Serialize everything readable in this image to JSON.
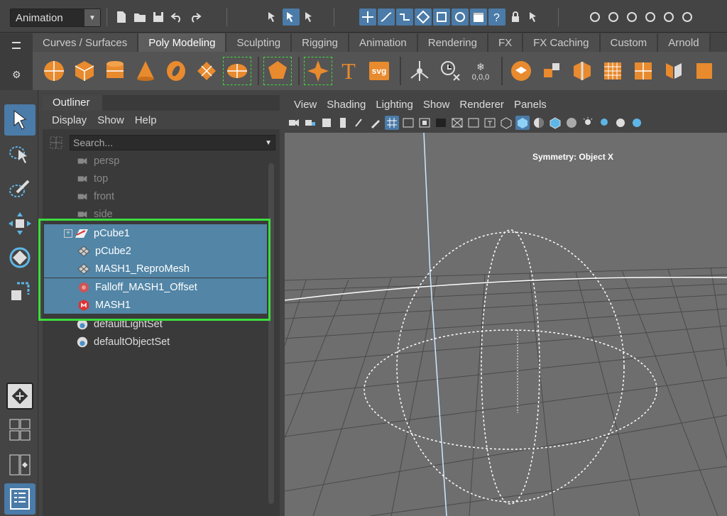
{
  "statusbar": {
    "menu_set": "Animation"
  },
  "shelf": {
    "tabs": [
      "Curves / Surfaces",
      "Poly Modeling",
      "Sculpting",
      "Rigging",
      "Animation",
      "Rendering",
      "FX",
      "FX Caching",
      "Custom",
      "Arnold"
    ],
    "active_tab": "Poly Modeling",
    "svg_label": "svg",
    "text_tool_label": "T",
    "snow_label": "0,0,0"
  },
  "outliner": {
    "tab": "Outliner",
    "menu": [
      "Display",
      "Show",
      "Help"
    ],
    "search_placeholder": "Search...",
    "items": [
      {
        "label": "persp",
        "icon": "camera-icon",
        "state": "dim"
      },
      {
        "label": "top",
        "icon": "camera-icon",
        "state": "dim"
      },
      {
        "label": "front",
        "icon": "camera-icon",
        "state": "dim"
      },
      {
        "label": "side",
        "icon": "camera-icon",
        "state": "dim"
      },
      {
        "label": "pCube1",
        "icon": "transform-icon",
        "state": "selected"
      },
      {
        "label": "pCube2",
        "icon": "mesh-icon",
        "state": "selected"
      },
      {
        "label": "MASH1_ReproMesh",
        "icon": "mesh-icon",
        "state": "selected"
      },
      {
        "label": "Falloff_MASH1_Offset",
        "icon": "falloff-icon",
        "state": "selected"
      },
      {
        "label": "MASH1",
        "icon": "mash-icon",
        "state": "selected"
      },
      {
        "label": "defaultLightSet",
        "icon": "set-icon",
        "state": "normal"
      },
      {
        "label": "defaultObjectSet",
        "icon": "set-icon",
        "state": "normal"
      }
    ]
  },
  "viewport": {
    "menu": [
      "View",
      "Shading",
      "Lighting",
      "Show",
      "Renderer",
      "Panels"
    ],
    "symmetry": "Symmetry: Object X"
  },
  "colors": {
    "selection": "#5285a6",
    "highlight_box": "#3ddc3d",
    "active_tool": "#4b7ba8"
  }
}
